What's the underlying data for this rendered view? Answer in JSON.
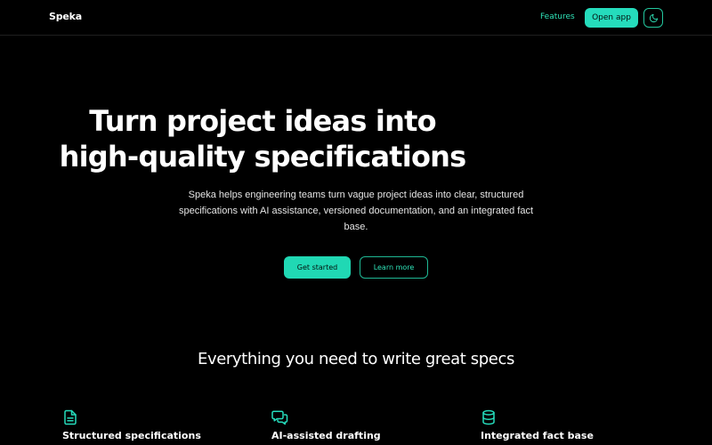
{
  "header": {
    "brand": "Speka",
    "nav": {
      "features_label": "Features"
    },
    "open_app_label": "Open app",
    "theme_toggle_icon": "moon-icon"
  },
  "hero": {
    "title_line1": "Turn project ideas into",
    "title_line2": "high-quality specifications",
    "subtitle": "Speka helps engineering teams turn vague project ideas into clear, structured specifications with AI assistance, versioned documentation, and an integrated fact base.",
    "primary_cta": "Get started",
    "secondary_cta": "Learn more"
  },
  "features": {
    "title": "Everything you need to write great specs",
    "items": [
      {
        "icon": "document-icon",
        "title": "Structured specifications"
      },
      {
        "icon": "chat-icon",
        "title": "AI-assisted drafting"
      },
      {
        "icon": "database-icon",
        "title": "Integrated fact base"
      }
    ]
  },
  "colors": {
    "background": "#000000",
    "accent": "#25dcbc",
    "text": "#ffffff"
  }
}
